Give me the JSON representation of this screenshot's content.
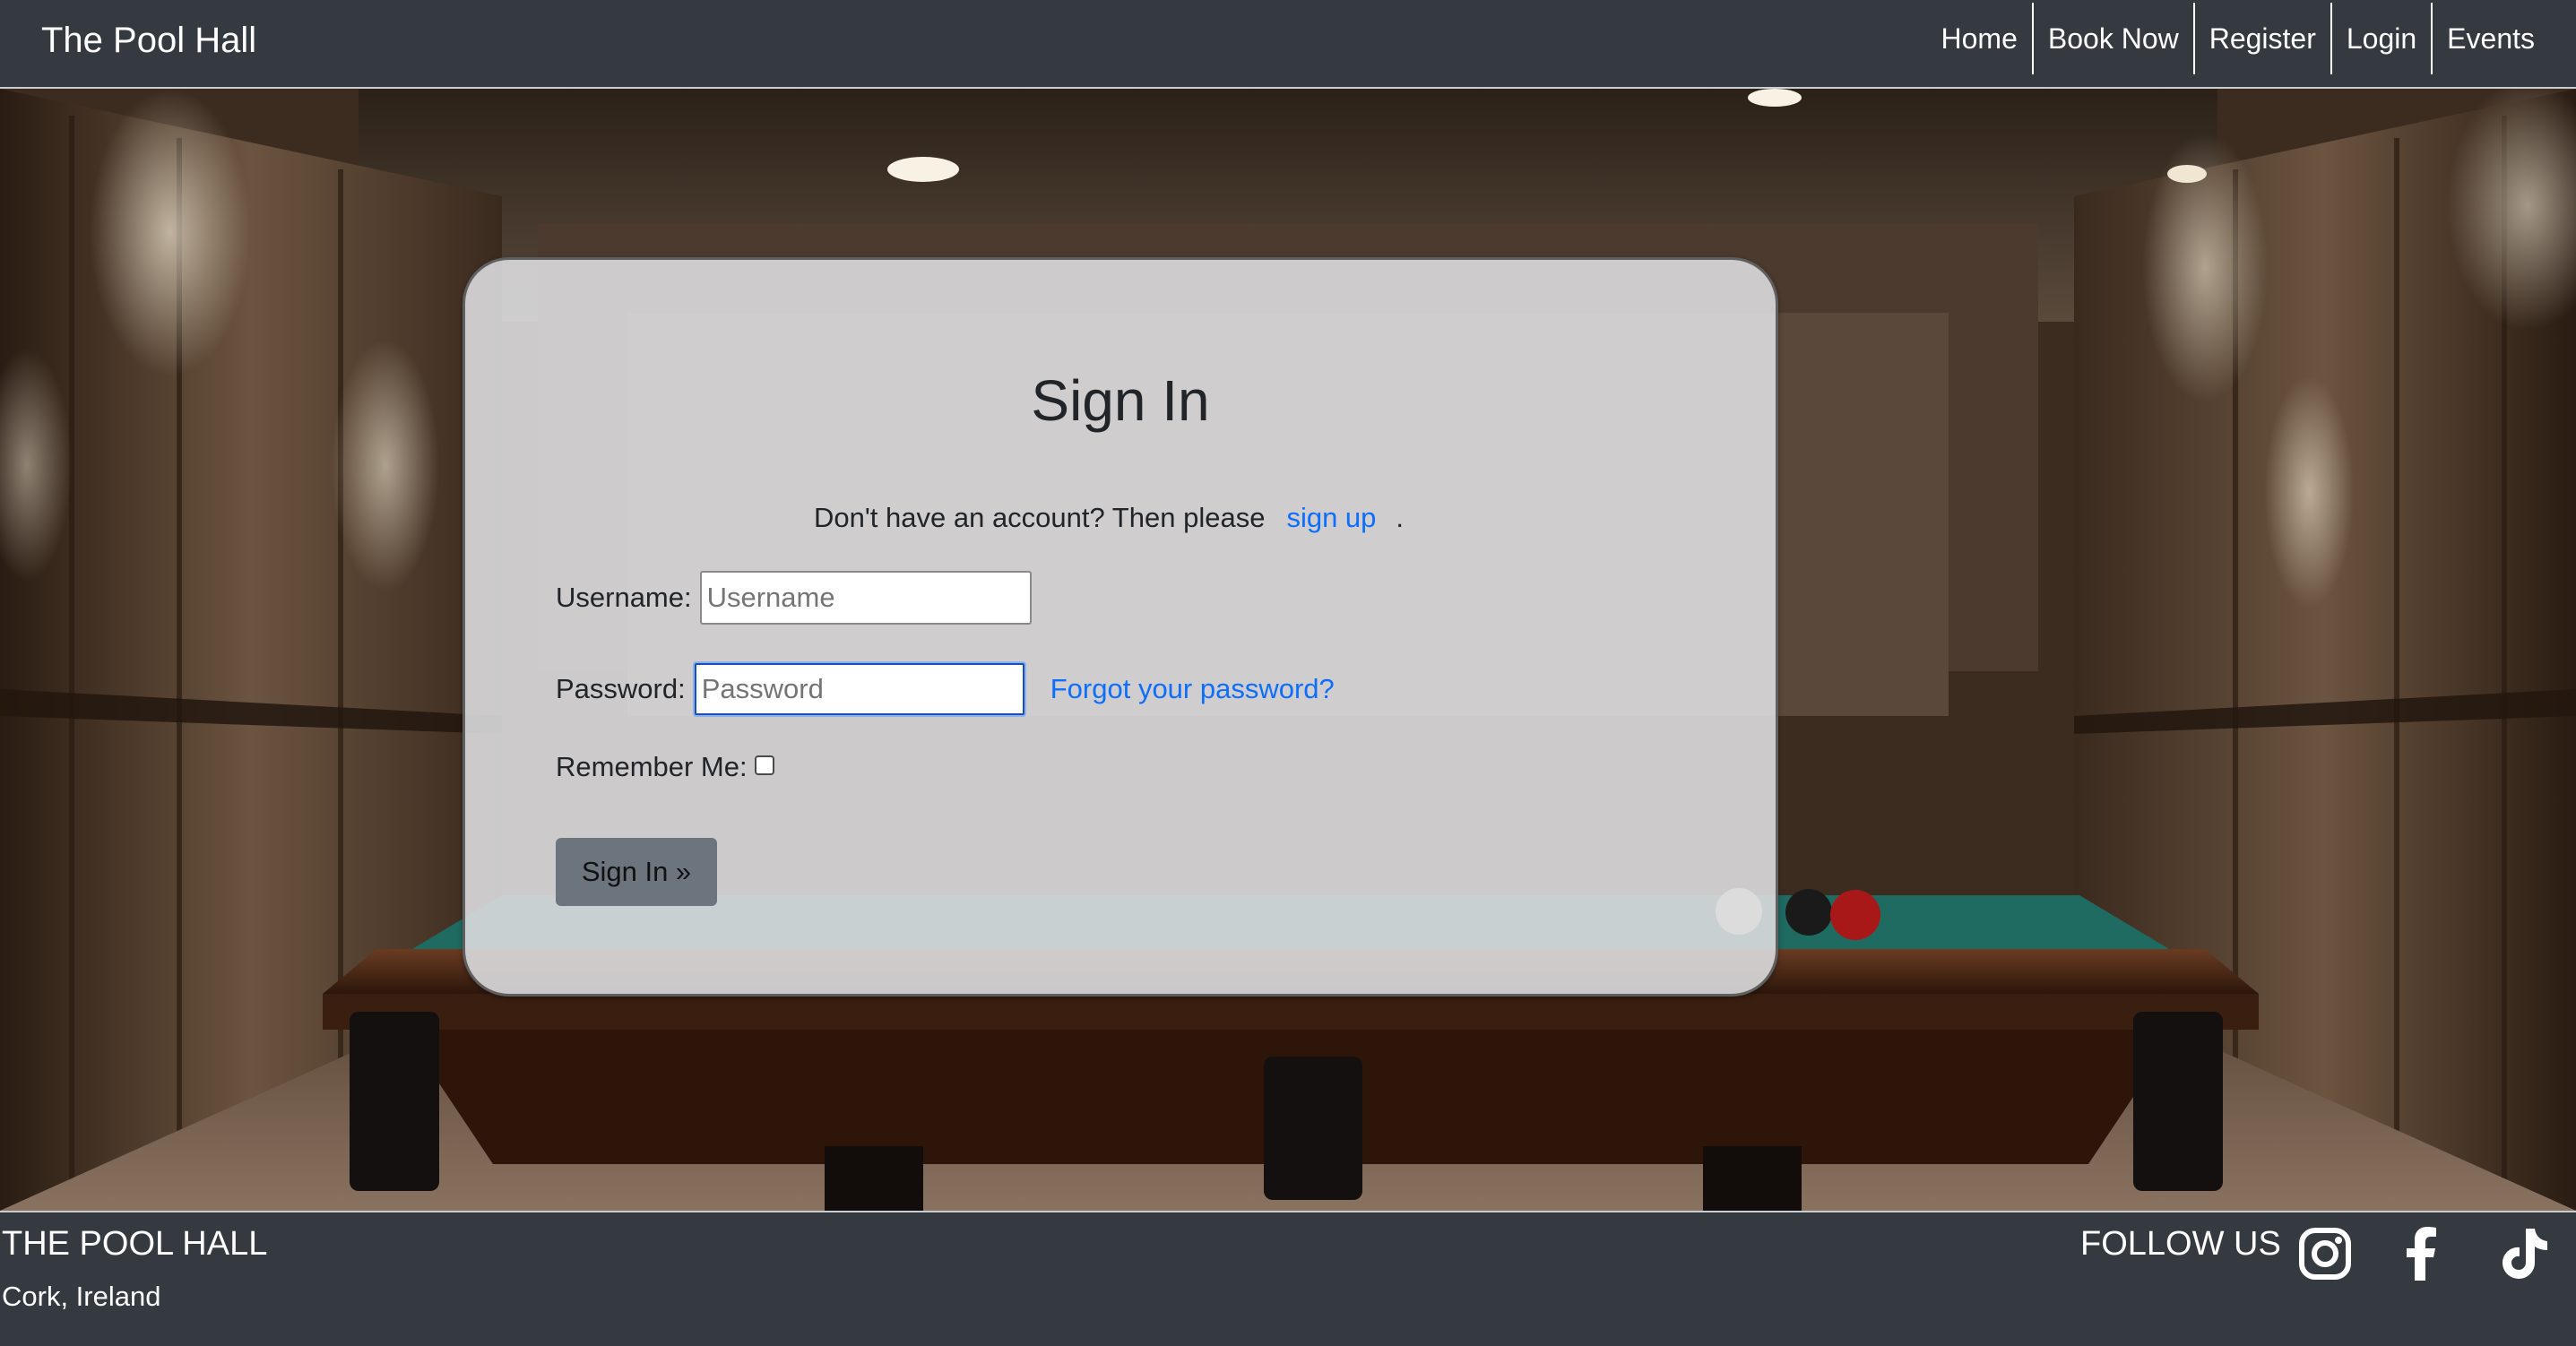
{
  "nav": {
    "brand": "The Pool Hall",
    "links": [
      {
        "label": "Home"
      },
      {
        "label": "Book Now"
      },
      {
        "label": "Register"
      },
      {
        "label": "Login"
      },
      {
        "label": "Events"
      }
    ]
  },
  "signin": {
    "title": "Sign In",
    "signup_prompt": "Don't have an account? Then please",
    "signup_link": "sign up",
    "signup_suffix": ".",
    "username_label": "Username:",
    "username_placeholder": "Username",
    "password_label": "Password:",
    "password_placeholder": "Password",
    "forgot_link": "Forgot your password?",
    "remember_label": "Remember Me:",
    "remember_checked": false,
    "submit_label": "Sign In »"
  },
  "footer": {
    "title": "THE POOL HALL",
    "location": "Cork, Ireland",
    "follow_label": "FOLLOW US",
    "social": [
      {
        "icon": "instagram-icon"
      },
      {
        "icon": "facebook-icon"
      },
      {
        "icon": "tiktok-icon"
      }
    ]
  },
  "colors": {
    "navbar_bg": "#343a40",
    "link": "#0d6efd",
    "button_bg": "#6c757d",
    "card_bg": "#dcdcde"
  }
}
